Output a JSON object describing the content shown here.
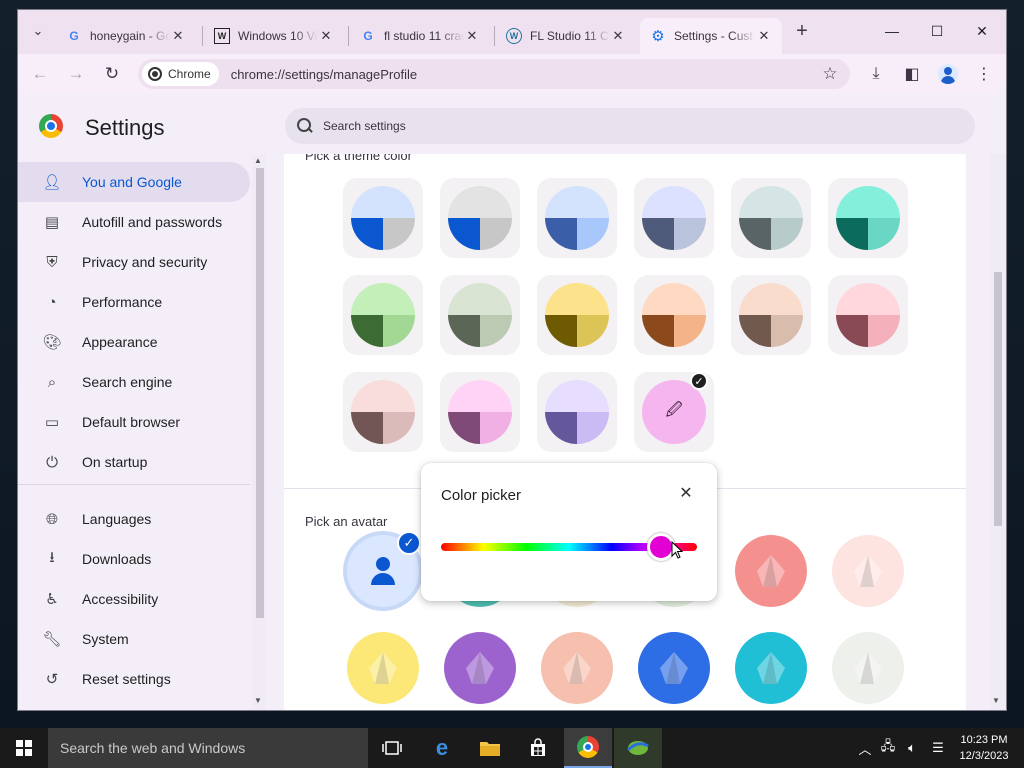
{
  "tabs": [
    {
      "title": "honeygain - Go",
      "favicon": "google-g-icon",
      "active": false
    },
    {
      "title": "Windows 10 Vi",
      "favicon": "wikipedia-icon",
      "active": false
    },
    {
      "title": "fl studio 11 crac",
      "favicon": "google-g-icon",
      "active": false
    },
    {
      "title": "FL Studio 11 Cr",
      "favicon": "wordpress-icon",
      "active": false
    },
    {
      "title": "Settings - Cust",
      "favicon": "gear-icon",
      "active": true
    }
  ],
  "toolbar": {
    "chip_label": "Chrome",
    "url": "chrome://settings/manageProfile"
  },
  "settings": {
    "title": "Settings",
    "search_placeholder": "Search settings"
  },
  "sidebar": {
    "items": [
      {
        "label": "You and Google",
        "icon": "person-icon",
        "active": true
      },
      {
        "label": "Autofill and passwords",
        "icon": "clipboard-icon"
      },
      {
        "label": "Privacy and security",
        "icon": "shield-icon"
      },
      {
        "label": "Performance",
        "icon": "speedometer-icon"
      },
      {
        "label": "Appearance",
        "icon": "palette-icon"
      },
      {
        "label": "Search engine",
        "icon": "search-icon"
      },
      {
        "label": "Default browser",
        "icon": "browser-icon"
      },
      {
        "label": "On startup",
        "icon": "power-icon"
      },
      {
        "label": "Languages",
        "icon": "globe-icon"
      },
      {
        "label": "Downloads",
        "icon": "download-icon"
      },
      {
        "label": "Accessibility",
        "icon": "accessibility-icon"
      },
      {
        "label": "System",
        "icon": "wrench-icon"
      },
      {
        "label": "Reset settings",
        "icon": "history-icon"
      }
    ]
  },
  "main": {
    "theme_section_title": "Pick a theme color",
    "avatar_section_title": "Pick an avatar",
    "theme_colors": [
      {
        "top": "#d3e3fd",
        "bl": "#0b57d0",
        "br": "#c7c7c7"
      },
      {
        "top": "#e3e3e3",
        "bl": "#0b57d0",
        "br": "#c7c7c7"
      },
      {
        "top": "#d3e3fd",
        "bl": "#3a5ea8",
        "br": "#a8c7fa"
      },
      {
        "top": "#dbe1ff",
        "bl": "#4f5b7a",
        "br": "#b9c3dc"
      },
      {
        "top": "#d5e5e5",
        "bl": "#586466",
        "br": "#b8cbcb"
      },
      {
        "top": "#84f0dc",
        "bl": "#0b6b5c",
        "br": "#6ad7c4"
      },
      {
        "top": "#c2f0b8",
        "bl": "#3c6b34",
        "br": "#a3d794"
      },
      {
        "top": "#d9e4d2",
        "bl": "#5b6656",
        "br": "#bccab3"
      },
      {
        "top": "#fce28a",
        "bl": "#6e5a00",
        "br": "#dcc456"
      },
      {
        "top": "#ffd9c2",
        "bl": "#8c4a1c",
        "br": "#f4b389"
      },
      {
        "top": "#fadccd",
        "bl": "#72594e",
        "br": "#d8bcac"
      },
      {
        "top": "#ffd7dd",
        "bl": "#8a4a55",
        "br": "#f4b0bb"
      },
      {
        "top": "#f9dcdc",
        "bl": "#725656",
        "br": "#dbbaba"
      },
      {
        "top": "#ffd3f5",
        "bl": "#7f4a78",
        "br": "#f0b0e4"
      },
      {
        "top": "#e7ddff",
        "bl": "#64579c",
        "br": "#cbbbf4"
      }
    ],
    "custom_color": {
      "fill": "#f5b6ef",
      "icon": "eyedropper-icon",
      "selected": true
    },
    "avatars": [
      {
        "name": "default-person",
        "bg": "#dbe7ff",
        "selected": true
      },
      {
        "name": "origami-cat",
        "bg": "#4fc2b5"
      },
      {
        "name": "origami-cream",
        "bg": "#f4ecd6"
      },
      {
        "name": "origami-green",
        "bg": "#e4efe0"
      },
      {
        "name": "origami-elephant",
        "bg": "#f4918f"
      },
      {
        "name": "origami-fox",
        "bg": "#fde4e1"
      },
      {
        "name": "origami-monkey",
        "bg": "#fbe877"
      },
      {
        "name": "origami-panda",
        "bg": "#9c63cf"
      },
      {
        "name": "origami-penguin",
        "bg": "#f6bfae"
      },
      {
        "name": "origami-butterfly",
        "bg": "#2d6ee6"
      },
      {
        "name": "origami-rabbit",
        "bg": "#20bfd6"
      },
      {
        "name": "origami-unicorn",
        "bg": "#eef0ec"
      }
    ]
  },
  "picker": {
    "title": "Color picker",
    "hue_fraction": 0.86,
    "thumb_color": "#e200d4"
  },
  "taskbar": {
    "search_placeholder": "Search the web and Windows",
    "time": "10:23 PM",
    "date": "12/3/2023"
  }
}
